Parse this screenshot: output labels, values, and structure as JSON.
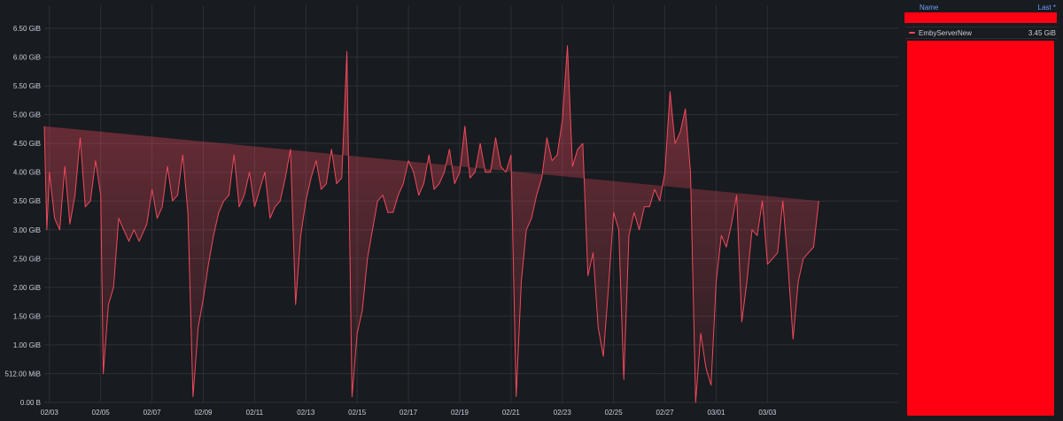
{
  "chart_data": {
    "type": "area",
    "title": "",
    "xlabel": "",
    "ylabel": "",
    "ylim_gib": [
      0,
      6.9
    ],
    "x_tick_labels": [
      "02/03",
      "02/05",
      "02/07",
      "02/09",
      "02/11",
      "02/13",
      "02/15",
      "02/17",
      "02/19",
      "02/21",
      "02/23",
      "02/25",
      "02/27",
      "03/01",
      "03/03"
    ],
    "y_tick_values_gib": [
      0,
      0.5,
      1.0,
      1.5,
      2.0,
      2.5,
      3.0,
      3.5,
      4.0,
      4.5,
      5.0,
      5.5,
      6.0,
      6.5
    ],
    "y_tick_labels": [
      "0.00 B",
      "512.00 MiB",
      "1.00 GiB",
      "1.50 GiB",
      "2.00 GiB",
      "2.50 GiB",
      "3.00 GiB",
      "3.50 GiB",
      "4.00 GiB",
      "4.50 GiB",
      "5.00 GiB",
      "5.50 GiB",
      "6.00 GiB",
      "6.50 GiB"
    ],
    "grid": true,
    "legend_placement": "right",
    "series": [
      {
        "name": "EmbyServerNew",
        "color": "#f2495c",
        "x_days": [
          0,
          0.1,
          0.2,
          0.4,
          0.6,
          0.8,
          1.0,
          1.2,
          1.4,
          1.6,
          1.8,
          2.0,
          2.2,
          2.3,
          2.5,
          2.7,
          2.9,
          3.1,
          3.3,
          3.5,
          3.7,
          4.0,
          4.2,
          4.4,
          4.6,
          4.8,
          5.0,
          5.2,
          5.4,
          5.6,
          5.8,
          6.0,
          6.2,
          6.4,
          6.6,
          6.8,
          7.0,
          7.2,
          7.4,
          7.6,
          7.8,
          8.0,
          8.2,
          8.4,
          8.6,
          8.8,
          9.0,
          9.2,
          9.4,
          9.6,
          9.8,
          10.0,
          10.2,
          10.4,
          10.6,
          10.8,
          11.0,
          11.2,
          11.4,
          11.6,
          11.8,
          12.0,
          12.2,
          12.4,
          12.6,
          12.8,
          13.0,
          13.2,
          13.4,
          13.6,
          13.8,
          14.0,
          14.2,
          14.4,
          14.6,
          14.8,
          15.0,
          15.2,
          15.4,
          15.6,
          15.8,
          16.0,
          16.2,
          16.4,
          16.6,
          16.8,
          17.0,
          17.2,
          17.4,
          17.6,
          17.8,
          18.0,
          18.2,
          18.4,
          18.6,
          18.8,
          19.0,
          19.2,
          19.4,
          19.6,
          19.8,
          20.0,
          20.2,
          20.4,
          20.6,
          20.8,
          21.0,
          21.2,
          21.4,
          21.6,
          21.8,
          22.0,
          22.2,
          22.4,
          22.6,
          22.8,
          23.0,
          23.2,
          23.4,
          23.6,
          23.8,
          24.0,
          24.2,
          24.4,
          24.6,
          24.8,
          25.0,
          25.2,
          25.4,
          25.6,
          25.8,
          26.0,
          26.2,
          26.4,
          26.6,
          26.8,
          27.0,
          27.2,
          27.4,
          27.6,
          27.8,
          28.0,
          28.2,
          28.4,
          28.6,
          28.8,
          29.0,
          29.2,
          29.4,
          29.6,
          29.8,
          30.0,
          30.2,
          30.4,
          30.6,
          30.8,
          31.0,
          31.2,
          31.4,
          31.6,
          31.8,
          32.0,
          32.2,
          32.4,
          32.6,
          32.8,
          33.0
        ],
        "values_gib": [
          4.8,
          3.0,
          4.0,
          3.2,
          3.0,
          4.1,
          3.1,
          3.6,
          4.6,
          3.4,
          3.5,
          4.2,
          3.6,
          0.5,
          1.7,
          2.0,
          3.2,
          3.0,
          2.8,
          3.0,
          2.8,
          3.1,
          3.7,
          3.2,
          3.4,
          4.1,
          3.5,
          3.6,
          4.3,
          3.3,
          0.1,
          1.3,
          1.8,
          2.4,
          2.9,
          3.3,
          3.5,
          3.6,
          4.3,
          3.4,
          3.6,
          4.0,
          3.4,
          3.7,
          4.0,
          3.2,
          3.4,
          3.5,
          3.9,
          4.4,
          1.7,
          2.9,
          3.5,
          3.9,
          4.2,
          3.7,
          3.8,
          4.4,
          3.8,
          3.9,
          6.1,
          0.1,
          1.2,
          1.6,
          2.5,
          3.0,
          3.5,
          3.6,
          3.3,
          3.3,
          3.6,
          3.8,
          4.2,
          4.0,
          3.6,
          3.8,
          4.3,
          3.7,
          3.8,
          4.0,
          4.4,
          3.8,
          4.0,
          4.8,
          3.9,
          4.0,
          4.5,
          4.0,
          4.0,
          4.6,
          4.1,
          4.0,
          4.3,
          0.1,
          2.1,
          3.0,
          3.2,
          3.6,
          3.9,
          4.6,
          4.2,
          4.3,
          4.9,
          6.2,
          4.1,
          4.4,
          4.5,
          2.2,
          2.6,
          1.3,
          0.8,
          2.0,
          3.3,
          3.0,
          0.4,
          2.9,
          3.3,
          3.0,
          3.4,
          3.4,
          3.7,
          3.5,
          4.0,
          5.4,
          4.5,
          4.7,
          5.1,
          4.0,
          0.0,
          1.2,
          0.6,
          0.3,
          2.1,
          2.9,
          2.7,
          3.1,
          3.6,
          1.4,
          2.1,
          3.0,
          2.9,
          3.5,
          2.4,
          2.5,
          2.6,
          3.5,
          2.4,
          1.1,
          2.1,
          2.5,
          2.6,
          2.7,
          3.5
        ],
        "last_label": "3.45 GiB"
      }
    ]
  },
  "legend": {
    "header_name": "Name",
    "header_last": "Last *",
    "series_name": "EmbyServerNew",
    "series_last": "3.45 GiB"
  }
}
